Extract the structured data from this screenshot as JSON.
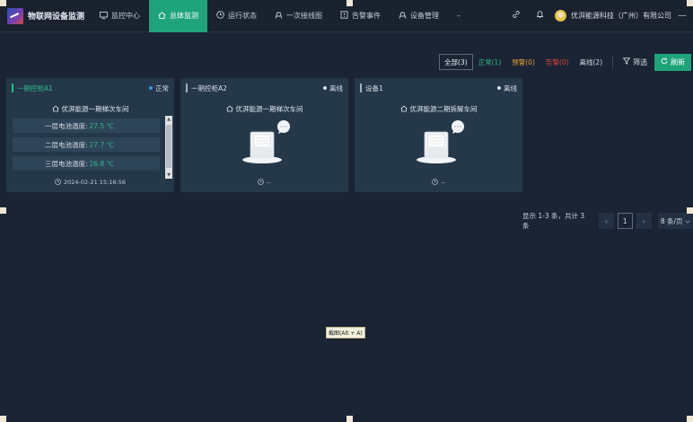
{
  "app": {
    "title": "物联网设备监测"
  },
  "nav": [
    {
      "label": "监控中心",
      "icon": "monitor-icon",
      "active": false
    },
    {
      "label": "总体监测",
      "icon": "home-icon",
      "active": true
    },
    {
      "label": "运行状态",
      "icon": "clock-icon",
      "active": false
    },
    {
      "label": "一次接线图",
      "icon": "diagram-icon",
      "active": false
    },
    {
      "label": "告警事件",
      "icon": "alert-icon",
      "active": false
    },
    {
      "label": "设备管理",
      "icon": "device-icon",
      "active": false
    }
  ],
  "nav_more": "–",
  "header": {
    "company": "优湃能源科技（广州）有限公司",
    "minus": "—"
  },
  "filters": [
    {
      "label": "全部(3)",
      "key": "all"
    },
    {
      "label": "正常(1)",
      "key": "normal"
    },
    {
      "label": "预警(0)",
      "key": "warn"
    },
    {
      "label": "告警(0)",
      "key": "alarm"
    },
    {
      "label": "离线(2)",
      "key": "off"
    }
  ],
  "filter_screen": "筛选",
  "refresh": "刷新",
  "cards": [
    {
      "name": "一期控柜A1",
      "status": "正常",
      "location": "优湃能源一期梯次车间",
      "rows": [
        {
          "label": "一层电池温度:",
          "value": "27.5 ℃"
        },
        {
          "label": "二层电池温度:",
          "value": "27.7 ℃"
        },
        {
          "label": "三层电池温度:",
          "value": "26.8 ℃"
        }
      ],
      "time": "2024-02-21 15:16:56"
    },
    {
      "name": "一期控柜A2",
      "status": "离线",
      "location": "优湃能源一期梯次车间",
      "time": "--"
    },
    {
      "name": "设备1",
      "status": "离线",
      "location": "优湃能源二期拆解车间",
      "time": "--"
    }
  ],
  "pager": {
    "info": "显示 1-3 条，共计 3 条",
    "page": "1",
    "size": "8 条/页"
  },
  "tooltip": "截图(Alt + A)",
  "colors": {
    "accent": "#1fa37a",
    "normal": "#2dbb8a",
    "warn": "#e8a13a",
    "alarm": "#d9483b",
    "bg": "#1b2434",
    "card": "#25384a"
  }
}
